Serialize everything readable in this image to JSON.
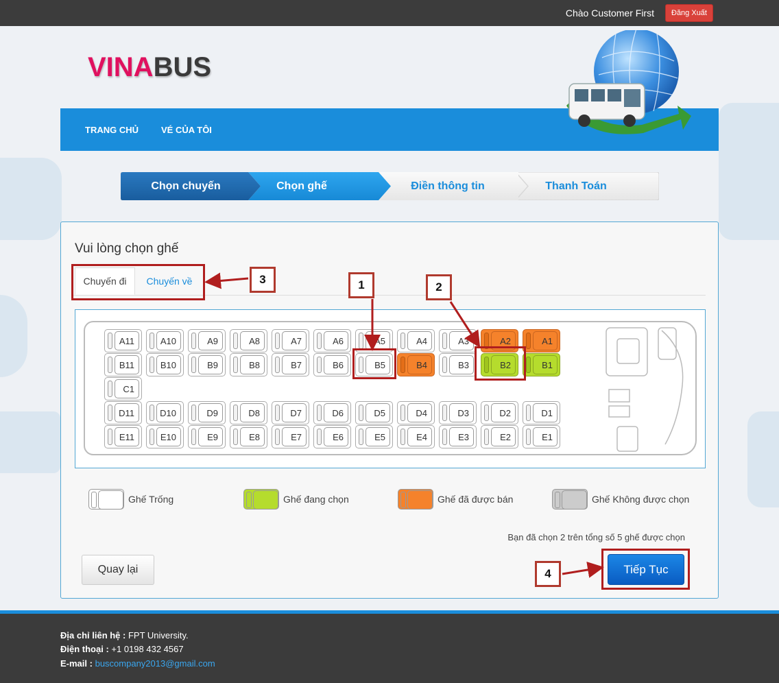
{
  "topbar": {
    "greeting": "Chào Customer First",
    "logout_label": "Đăng Xuất"
  },
  "logo": {
    "part1": "VINA",
    "part2": "BUS"
  },
  "nav": {
    "items": [
      {
        "label": "TRANG CHỦ"
      },
      {
        "label": "VÉ CỦA TÔI"
      }
    ]
  },
  "steps": [
    {
      "label": "Chọn chuyến",
      "state": "done"
    },
    {
      "label": "Chọn ghế",
      "state": "active"
    },
    {
      "label": "Điền thông tin",
      "state": "pending"
    },
    {
      "label": "Thanh Toán",
      "state": "pending"
    }
  ],
  "panel": {
    "title": "Vui lòng chọn ghế",
    "tabs": [
      {
        "label": "Chuyến đi",
        "active": true
      },
      {
        "label": "Chuyến về",
        "active": false
      }
    ]
  },
  "seats": [
    [
      {
        "id": "A11",
        "s": "empty"
      },
      {
        "id": "A10",
        "s": "empty"
      },
      {
        "id": "A9",
        "s": "empty"
      },
      {
        "id": "A8",
        "s": "empty"
      },
      {
        "id": "A7",
        "s": "empty"
      },
      {
        "id": "A6",
        "s": "empty"
      },
      {
        "id": "A5",
        "s": "empty"
      },
      {
        "id": "A4",
        "s": "empty"
      },
      {
        "id": "A3",
        "s": "empty"
      },
      {
        "id": "A2",
        "s": "sold"
      },
      {
        "id": "A1",
        "s": "sold"
      }
    ],
    [
      {
        "id": "B11",
        "s": "empty"
      },
      {
        "id": "B10",
        "s": "empty"
      },
      {
        "id": "B9",
        "s": "empty"
      },
      {
        "id": "B8",
        "s": "empty"
      },
      {
        "id": "B7",
        "s": "empty"
      },
      {
        "id": "B6",
        "s": "empty"
      },
      {
        "id": "B5",
        "s": "empty"
      },
      {
        "id": "B4",
        "s": "sold"
      },
      {
        "id": "B3",
        "s": "empty"
      },
      {
        "id": "B2",
        "s": "selected"
      },
      {
        "id": "B1",
        "s": "selected"
      }
    ],
    [
      {
        "id": "C1",
        "s": "empty"
      }
    ],
    [
      {
        "id": "D11",
        "s": "empty"
      },
      {
        "id": "D10",
        "s": "empty"
      },
      {
        "id": "D9",
        "s": "empty"
      },
      {
        "id": "D8",
        "s": "empty"
      },
      {
        "id": "D7",
        "s": "empty"
      },
      {
        "id": "D6",
        "s": "empty"
      },
      {
        "id": "D5",
        "s": "empty"
      },
      {
        "id": "D4",
        "s": "empty"
      },
      {
        "id": "D3",
        "s": "empty"
      },
      {
        "id": "D2",
        "s": "empty"
      },
      {
        "id": "D1",
        "s": "empty"
      }
    ],
    [
      {
        "id": "E11",
        "s": "empty"
      },
      {
        "id": "E10",
        "s": "empty"
      },
      {
        "id": "E9",
        "s": "empty"
      },
      {
        "id": "E8",
        "s": "empty"
      },
      {
        "id": "E7",
        "s": "empty"
      },
      {
        "id": "E6",
        "s": "empty"
      },
      {
        "id": "E5",
        "s": "empty"
      },
      {
        "id": "E4",
        "s": "empty"
      },
      {
        "id": "E3",
        "s": "empty"
      },
      {
        "id": "E2",
        "s": "empty"
      },
      {
        "id": "E1",
        "s": "empty"
      }
    ]
  ],
  "legend": [
    {
      "label": "Ghế Trống",
      "color": "#ffffff"
    },
    {
      "label": "Ghế đang chọn",
      "color": "#b5dc2d"
    },
    {
      "label": "Ghế đã được bán",
      "color": "#f5822b"
    },
    {
      "label": "Ghế Không được chọn",
      "color": "#cccccc"
    }
  ],
  "summary": "Bạn đã chọn 2 trên tổng số 5 ghế được chọn",
  "buttons": {
    "back": "Quay lại",
    "next": "Tiếp Tục"
  },
  "annotations": {
    "n1": "1",
    "n2": "2",
    "n3": "3",
    "n4": "4"
  },
  "footer": {
    "address_label": "Địa chỉ liên hệ :",
    "address_value": " FPT University.",
    "phone_label": "Điện thoại :",
    "phone_value": " +1 0198 432 4567",
    "email_label": "E-mail :",
    "email_value": "buscompany2013@gmail.com"
  },
  "colors": {
    "brand_blue": "#1a8ddb",
    "logo_pink": "#e0115f",
    "sold": "#f5822b",
    "selected": "#b5dc2d",
    "annotation_red": "#b01e1e"
  }
}
